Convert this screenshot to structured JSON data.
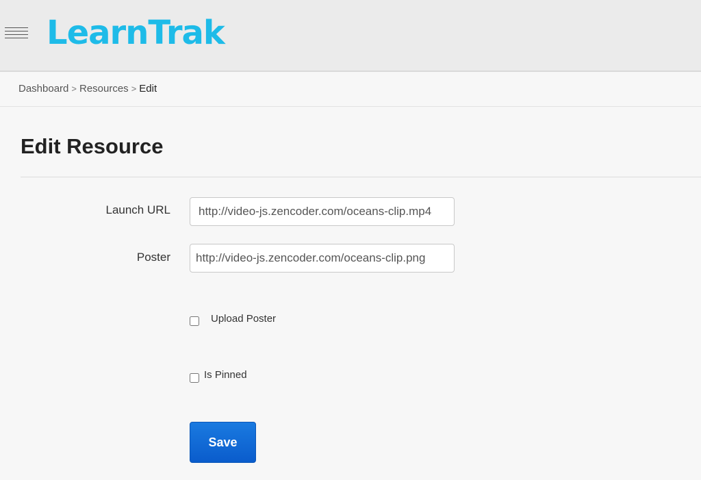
{
  "header": {
    "logo_text": "LearnTrak",
    "menu_icon": "hamburger-menu-icon",
    "brand_color": "#1ebbe8"
  },
  "breadcrumb": {
    "items": [
      "Dashboard",
      "Resources"
    ],
    "separator": ">",
    "current": "Edit"
  },
  "page": {
    "title": "Edit Resource"
  },
  "form": {
    "launch_url": {
      "label": "Launch URL",
      "value": "http://video-js.zencoder.com/oceans-clip.mp4"
    },
    "poster": {
      "label": "Poster",
      "value": "http://video-js.zencoder.com/oceans-clip.png"
    },
    "upload_poster": {
      "label": "Upload Poster",
      "checked": false
    },
    "is_pinned": {
      "label": "Is Pinned",
      "checked": false
    },
    "save_label": "Save",
    "save_color": "#0a5ccc"
  }
}
